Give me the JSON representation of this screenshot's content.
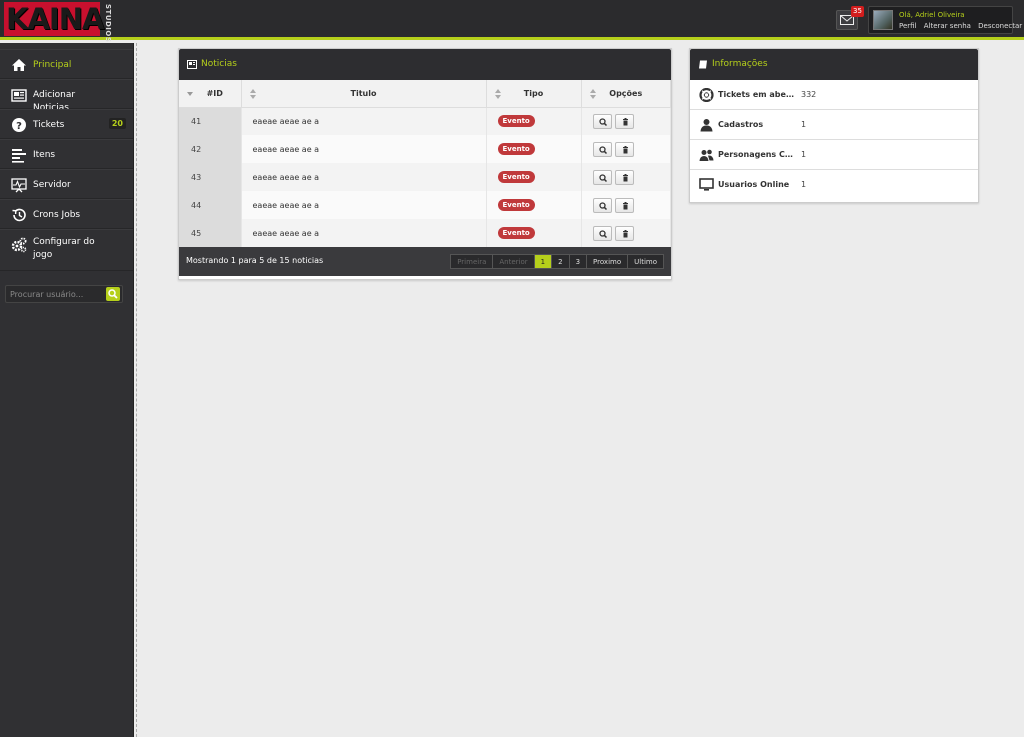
{
  "brand": {
    "logo_text": "KAINA",
    "sub_text": "STUDIOS"
  },
  "header": {
    "mail_count": "35",
    "greeting": "Olá, Adriel Oliveira",
    "links": [
      "Perfil",
      "Alterar senha",
      "Desconectar"
    ]
  },
  "sidebar": {
    "items": [
      {
        "label": "Principal",
        "icon": "home-icon",
        "active": true
      },
      {
        "label": "Adicionar Noticias",
        "icon": "newspaper-icon"
      },
      {
        "label": "Tickets",
        "icon": "question-icon",
        "badge": "20"
      },
      {
        "label": "Itens",
        "icon": "list-icon"
      },
      {
        "label": "Servidor",
        "icon": "monitor-pulse-icon"
      },
      {
        "label": "Crons Jobs",
        "icon": "history-icon"
      },
      {
        "label": "Configurar do jogo",
        "icon": "gears-icon"
      }
    ],
    "search_placeholder": "Procurar usuário..."
  },
  "news": {
    "title": "Noticias",
    "columns": [
      "#ID",
      "Titulo",
      "Tipo",
      "Opções"
    ],
    "rows": [
      {
        "id": "41",
        "title": "eaeae aeae ae a",
        "type": "Evento"
      },
      {
        "id": "42",
        "title": "eaeae aeae ae a",
        "type": "Evento"
      },
      {
        "id": "43",
        "title": "eaeae aeae ae a",
        "type": "Evento"
      },
      {
        "id": "44",
        "title": "eaeae aeae ae a",
        "type": "Evento"
      },
      {
        "id": "45",
        "title": "eaeae aeae ae a",
        "type": "Evento"
      }
    ],
    "footer_info": "Mostrando 1 para 5 de 15 noticias",
    "pager": {
      "first": "Primeira",
      "prev": "Anterior",
      "pages": [
        "1",
        "2",
        "3"
      ],
      "current": "1",
      "next": "Proximo",
      "last": "Ultimo"
    }
  },
  "info": {
    "title": "Informações",
    "rows": [
      {
        "label": "Tickets em aberto",
        "value": "332",
        "icon": "lifebuoy-icon"
      },
      {
        "label": "Cadastros",
        "value": "1",
        "icon": "user-icon"
      },
      {
        "label": "Personagens Criados",
        "value": "1",
        "icon": "users-icon"
      },
      {
        "label": "Usuarios Online",
        "value": "1",
        "icon": "monitor-icon"
      }
    ]
  },
  "colors": {
    "accent": "#b5cf1b",
    "brand_red": "#c8102e",
    "dark": "#2d2d30",
    "pill": "#c0393b"
  }
}
